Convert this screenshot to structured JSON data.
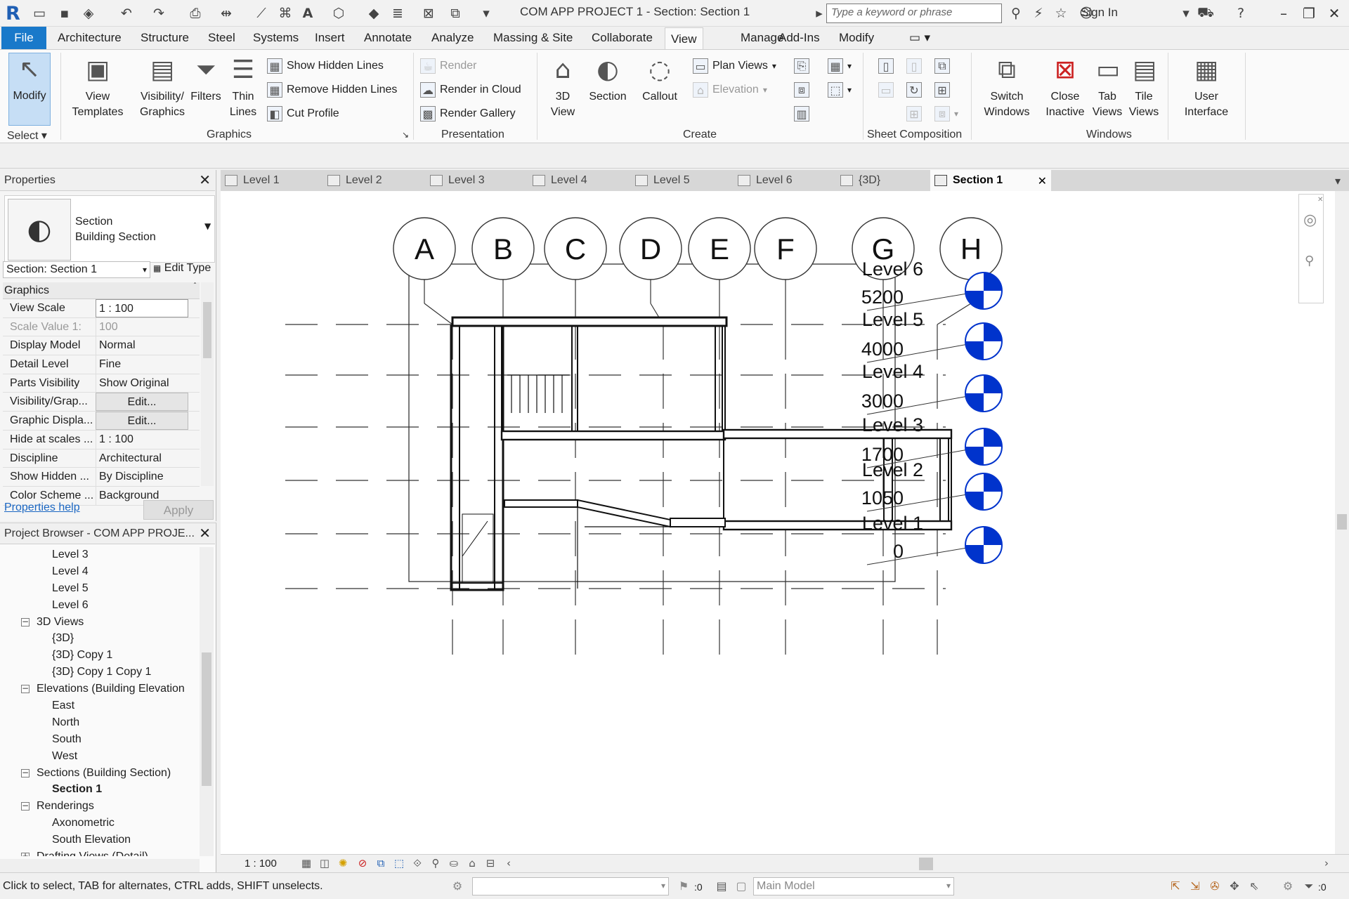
{
  "window": {
    "title": "COM APP PROJECT 1 - Section: Section 1",
    "search_placeholder": "Type a keyword or phrase",
    "signin_label": "Sign In"
  },
  "ribbon_tabs": [
    "File",
    "Architecture",
    "Structure",
    "Steel",
    "Systems",
    "Insert",
    "Annotate",
    "Analyze",
    "Massing & Site",
    "Collaborate",
    "View",
    "Manage",
    "Add-Ins",
    "Modify"
  ],
  "active_tab": "View",
  "ribbon": {
    "select": {
      "modify": "Modify",
      "select_label": "Select"
    },
    "graphics": {
      "label": "Graphics",
      "view_templates": [
        "View",
        "Templates"
      ],
      "visibility_graphics": [
        "Visibility/",
        "Graphics"
      ],
      "filters": "Filters",
      "thin_lines": [
        "Thin",
        "Lines"
      ],
      "show_hidden": "Show  Hidden Lines",
      "remove_hidden": "Remove  Hidden Lines",
      "cut_profile": "Cut  Profile"
    },
    "presentation": {
      "label": "Presentation",
      "render": "Render",
      "render_cloud": "Render  in Cloud",
      "render_gallery": "Render  Gallery"
    },
    "create": {
      "label": "Create",
      "view_3d": [
        "3D",
        "View"
      ],
      "section": "Section",
      "callout": "Callout",
      "plan_views": "Plan  Views",
      "elevation": "Elevation"
    },
    "sheet_composition": {
      "label": "Sheet Composition"
    },
    "windows": {
      "label": "Windows",
      "switch_windows": [
        "Switch",
        "Windows"
      ],
      "close_inactive": [
        "Close",
        "Inactive"
      ],
      "tab_views": [
        "Tab",
        "Views"
      ],
      "tile_views": [
        "Tile",
        "Views"
      ],
      "user_interface": [
        "User",
        "Interface"
      ]
    }
  },
  "properties": {
    "title": "Properties",
    "type_family": "Section",
    "type_name": "Building Section",
    "instance": "Section: Section 1",
    "edit_type": "Edit Type",
    "group": "Graphics",
    "rows": [
      {
        "name": "View Scale",
        "value": "1 : 100",
        "kind": "box"
      },
      {
        "name": "Scale Value    1:",
        "value": "100",
        "kind": "dim"
      },
      {
        "name": "Display Model",
        "value": "Normal",
        "kind": "text"
      },
      {
        "name": "Detail Level",
        "value": "Fine",
        "kind": "text"
      },
      {
        "name": "Parts Visibility",
        "value": "Show Original",
        "kind": "text"
      },
      {
        "name": "Visibility/Grap...",
        "value": "Edit...",
        "kind": "btn"
      },
      {
        "name": "Graphic Displa...",
        "value": "Edit...",
        "kind": "btn"
      },
      {
        "name": "Hide at scales ...",
        "value": "1 : 100",
        "kind": "text"
      },
      {
        "name": "Discipline",
        "value": "Architectural",
        "kind": "text"
      },
      {
        "name": "Show Hidden ...",
        "value": "By Discipline",
        "kind": "text"
      },
      {
        "name": "Color Scheme ...",
        "value": "Background",
        "kind": "text"
      }
    ],
    "help": "Properties help",
    "apply": "Apply"
  },
  "browser": {
    "title": "Project Browser - COM APP PROJE...",
    "nodes": [
      {
        "label": "Level 3",
        "depth": 2
      },
      {
        "label": "Level 4",
        "depth": 2
      },
      {
        "label": "Level 5",
        "depth": 2
      },
      {
        "label": "Level 6",
        "depth": 2
      },
      {
        "label": "3D Views",
        "depth": 1,
        "expander": "−"
      },
      {
        "label": "{3D}",
        "depth": 2
      },
      {
        "label": "{3D} Copy 1",
        "depth": 2
      },
      {
        "label": "{3D} Copy 1 Copy 1",
        "depth": 2
      },
      {
        "label": "Elevations (Building Elevation",
        "depth": 1,
        "expander": "−"
      },
      {
        "label": "East",
        "depth": 2
      },
      {
        "label": "North",
        "depth": 2
      },
      {
        "label": "South",
        "depth": 2
      },
      {
        "label": "West",
        "depth": 2
      },
      {
        "label": "Sections (Building Section)",
        "depth": 1,
        "expander": "−"
      },
      {
        "label": "Section 1",
        "depth": 2,
        "selected": true
      },
      {
        "label": "Renderings",
        "depth": 1,
        "expander": "−"
      },
      {
        "label": "Axonometric",
        "depth": 2
      },
      {
        "label": "South Elevation",
        "depth": 2
      },
      {
        "label": "Drafting Views (Detail)",
        "depth": 1,
        "expander": "+"
      }
    ]
  },
  "doc_tabs": [
    "Level 1",
    "Level 2",
    "Level 3",
    "Level 4",
    "Level 5",
    "Level 6",
    "{3D}",
    "Section 1"
  ],
  "active_doc_tab": "Section 1",
  "drawing": {
    "grids": [
      "A",
      "B",
      "C",
      "D",
      "E",
      "F",
      "G",
      "H"
    ],
    "levels": [
      {
        "name": "Level 6",
        "elevation": "5200"
      },
      {
        "name": "Level 5",
        "elevation": "4000"
      },
      {
        "name": "Level 4",
        "elevation": "3000"
      },
      {
        "name": "Level 3",
        "elevation": "1700"
      },
      {
        "name": "Level 2",
        "elevation": "1050"
      },
      {
        "name": "Level 1",
        "elevation": "0"
      }
    ],
    "level_marker_color": "#0033cc"
  },
  "view_bar": {
    "scale": "1 : 100"
  },
  "status": {
    "message": "Click to select, TAB for alternates, CTRL adds, SHIFT unselects.",
    "count": ":0",
    "design_option": "Main Model",
    "filter_count": ":0"
  }
}
